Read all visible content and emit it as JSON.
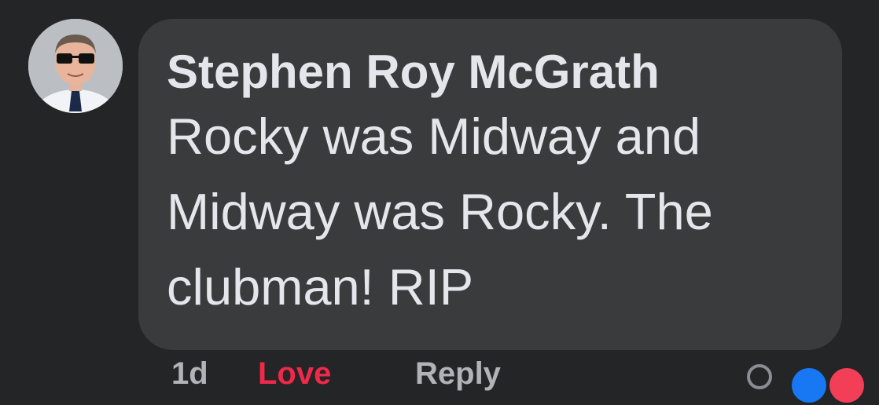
{
  "comment": {
    "author": "Stephen Roy McGrath",
    "text": "Rocky was Midway and Midway was Rocky. The clubman! RIP"
  },
  "actions": {
    "time": "1d",
    "like_label": "Love",
    "reply_label": "Reply"
  },
  "reactions": {
    "icons": [
      "like-icon",
      "love-icon"
    ]
  },
  "colors": {
    "background": "#242526",
    "bubble": "#3a3b3c",
    "text": "#e4e6eb",
    "love": "#f02849",
    "like": "#1877f2"
  }
}
